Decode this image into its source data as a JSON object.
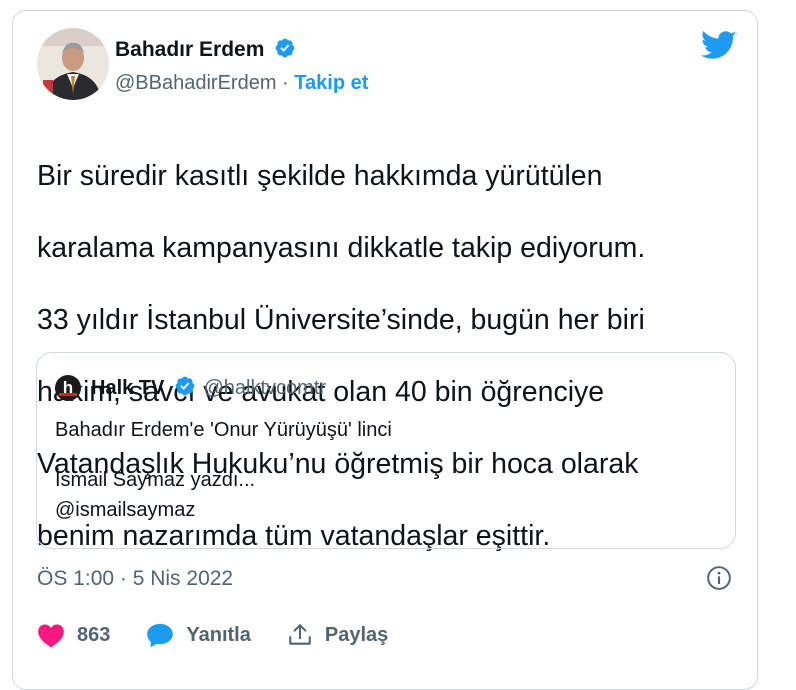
{
  "tweet": {
    "author": {
      "name": "Bahadır Erdem",
      "handle": "@BBahadirErdem",
      "separator": "·",
      "follow_label": "Takip et"
    },
    "text_lines": [
      "Bir süredir kasıtlı şekilde hakkımda yürütülen",
      "karalama kampanyasını dikkatle takip ediyorum.",
      "33 yıldır İstanbul Üniversite’sinde, bugün her biri",
      "hakim, savcı ve avukat olan 40 bin öğrenciye",
      "Vatandaşlık Hukuku’nu öğretmiş bir hoca olarak",
      "benim nazarımda tüm vatandaşlar eşittir."
    ],
    "quote": {
      "logo_letter": "h",
      "name": "Halk TV",
      "handle": "@halktvcomtr",
      "line1": "Bahadır Erdem'e 'Onur Yürüyüşü' linci",
      "line2": "İsmail Saymaz yazdı...",
      "line3": "@ismailsaymaz"
    },
    "timestamp": "ÖS 1:00 · 5 Nis 2022",
    "actions": {
      "like_count": "863",
      "reply_label": "Yanıtla",
      "share_label": "Paylaş"
    }
  },
  "colors": {
    "accent": "#1d9bf0",
    "like": "#f91880",
    "muted": "#536471",
    "border": "#cfd9de"
  },
  "icons": [
    "avatar-photo",
    "verified-badge-icon",
    "twitter-bird-icon",
    "halktv-logo",
    "info-icon",
    "heart-icon",
    "reply-bubble-icon",
    "share-icon"
  ]
}
